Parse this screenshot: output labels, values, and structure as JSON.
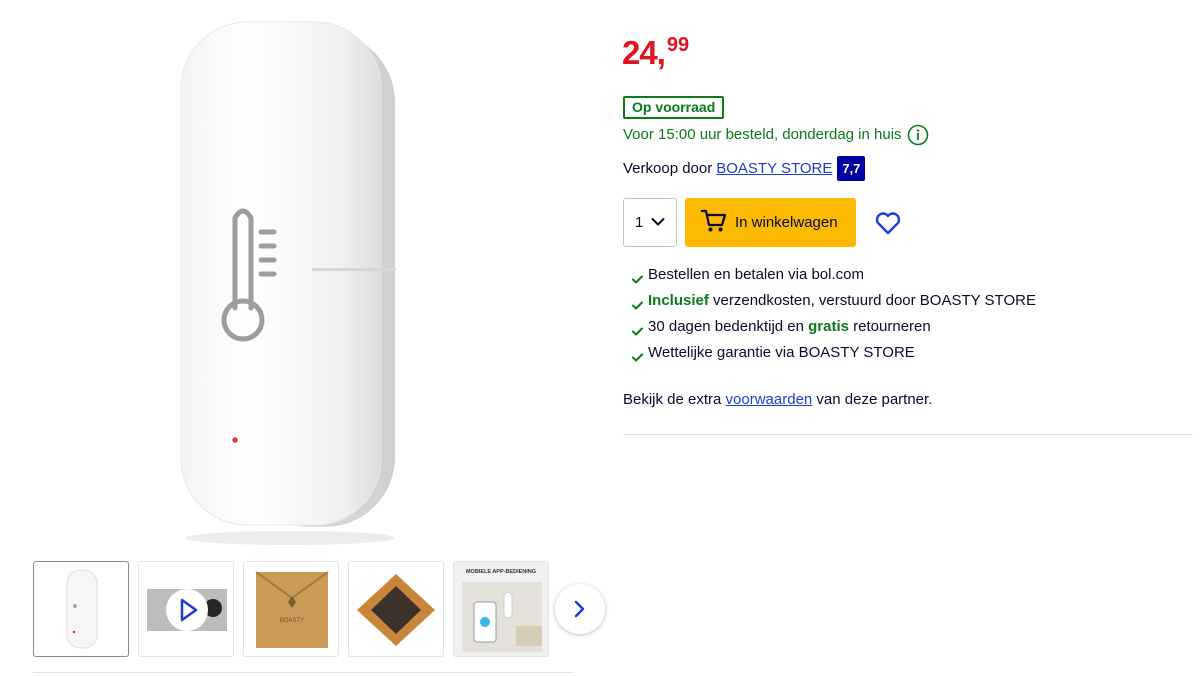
{
  "product": {
    "images": {
      "main_alt": "",
      "thumbnails": [
        {
          "kind": "product",
          "active": true
        },
        {
          "kind": "video"
        },
        {
          "kind": "packaging"
        },
        {
          "kind": "pad"
        },
        {
          "kind": "app",
          "caption": "MOBIELE APP-BEDIENING"
        }
      ],
      "packaging_brand": "BOASTY"
    },
    "price": {
      "whole": "24",
      "comma": ",",
      "fraction": "99"
    },
    "stock_label": "Op voorraad",
    "delivery_text": "Voor 15:00 uur besteld, donderdag in huis",
    "seller": {
      "prefix": "Verkoop door",
      "name": "BOASTY STORE",
      "score": "7,7"
    },
    "quantity": "1",
    "cart_label": "In winkelwagen",
    "usps": [
      {
        "parts": [
          {
            "t": "Bestellen en betalen via bol.com",
            "b": false
          }
        ]
      },
      {
        "parts": [
          {
            "t": "Inclusief",
            "b": true
          },
          {
            "t": " verzendkosten, verstuurd door BOASTY STORE",
            "b": false
          }
        ]
      },
      {
        "parts": [
          {
            "t": "30 dagen bedenktijd en ",
            "b": false
          },
          {
            "t": "gratis",
            "b": true
          },
          {
            "t": " retourneren",
            "b": false
          }
        ]
      },
      {
        "parts": [
          {
            "t": "Wettelijke garantie via BOASTY STORE",
            "b": false
          }
        ]
      }
    ],
    "terms": {
      "before": "Bekijk de extra ",
      "link": "voorwaarden",
      "after": " van deze partner."
    }
  },
  "colors": {
    "price": "#e0141e",
    "stock_green": "#0a7a1a",
    "link_blue": "#1e3bd6",
    "score_bg": "#0000a4",
    "cart_button": "#fbba00",
    "icons": {
      "info": "info-circle-icon",
      "cart": "cart-icon",
      "wishlist": "heart-icon",
      "check": "check-icon",
      "next": "chevron-right-icon",
      "play": "play-icon",
      "dropdown": "chevron-down-icon"
    }
  }
}
